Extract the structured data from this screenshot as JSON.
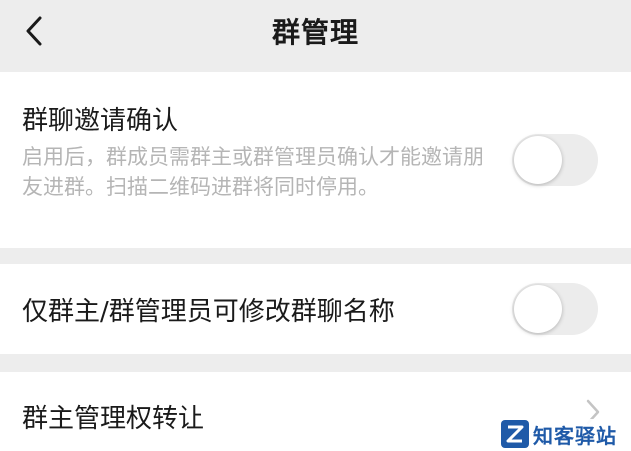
{
  "navbar": {
    "title": "群管理",
    "back_icon": "chevron-left-icon"
  },
  "settings": {
    "invite_confirm": {
      "title": "群聊邀请确认",
      "description": "启用后，群成员需群主或群管理员确认才能邀请朋友进群。扫描二维码进群将同时停用。",
      "enabled": false
    },
    "rename_restrict": {
      "title": "仅群主/群管理员可修改群聊名称",
      "enabled": false
    },
    "transfer_owner": {
      "title": "群主管理权转让",
      "icon": "chevron-right-icon"
    }
  },
  "watermark": {
    "text": "知客驿站",
    "logo_letter": "Z"
  },
  "colors": {
    "background": "#ededed",
    "card": "#ffffff",
    "title_text": "#1a1a1a",
    "description_text": "#b5b5b5",
    "toggle_off": "#ececec"
  }
}
